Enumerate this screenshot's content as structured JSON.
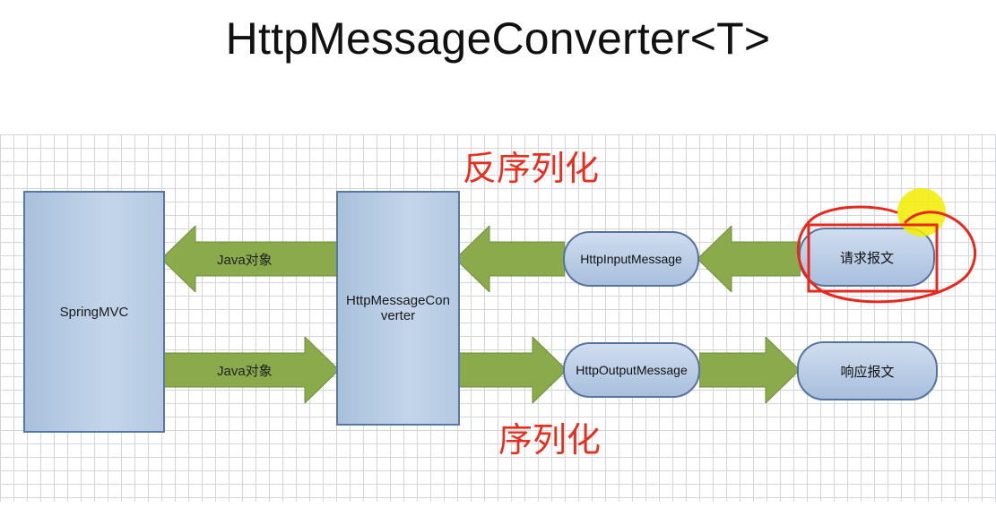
{
  "title": "HttpMessageConverter<T>",
  "diagram": {
    "springmvc_label": "SpringMVC",
    "converter_label_line1": "HttpMessageCon",
    "converter_label_line2": "verter",
    "input_message_label": "HttpInputMessage",
    "output_message_label": "HttpOutputMessage",
    "request_label": "请求报文",
    "response_label": "响应报文",
    "java_object_top": "Java对象",
    "java_object_bottom": "Java对象",
    "deserialize_label": "反序列化",
    "serialize_label": "序列化"
  },
  "colors": {
    "box_fill": "#b4c9e2",
    "box_border": "#5877a2",
    "arrow_fill": "#8aaa4b",
    "annotation_red": "#e53020",
    "highlight_yellow": "#f3ec00"
  }
}
